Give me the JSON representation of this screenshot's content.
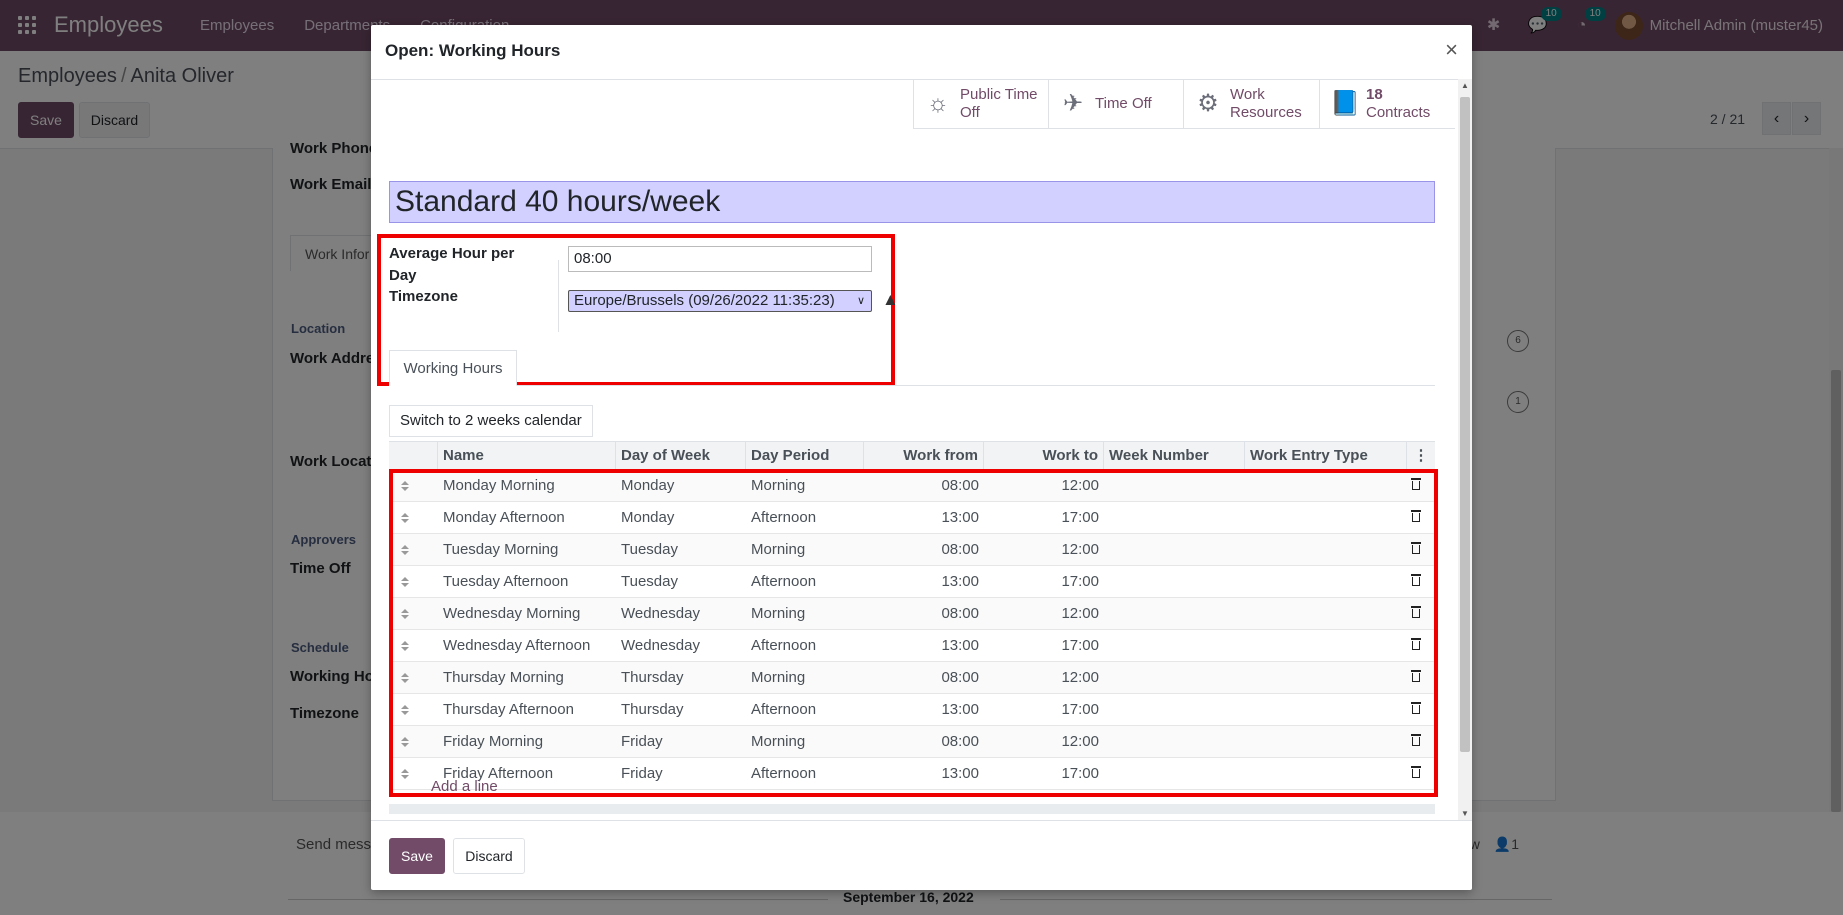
{
  "navbar": {
    "app_name": "Employees",
    "menu": [
      "Employees",
      "Departments",
      "Configuration"
    ],
    "chat_count": "10",
    "activity_count": "10",
    "user": "Mitchell Admin (muster45)"
  },
  "control": {
    "breadcrumb_parent": "Employees",
    "breadcrumb_current": "Anita Oliver",
    "save": "Save",
    "discard": "Discard",
    "pager": "2 / 21"
  },
  "background_form": {
    "work_phone": "Work Phone",
    "work_email": "Work Email",
    "tab_work_info": "Work Infor",
    "section_location": "Location",
    "work_address": "Work Addre",
    "work_location": "Work Locat",
    "section_approvers": "Approvers",
    "time_off": "Time Off",
    "section_schedule": "Schedule",
    "working_hours": "Working Ho",
    "timezone": "Timezone",
    "badge_1": "6",
    "badge_2": "1"
  },
  "chatter": {
    "send_message": "Send messa",
    "follow": "ow",
    "followers": "1",
    "date": "September 16, 2022"
  },
  "modal": {
    "title": "Open: Working Hours",
    "stat_buttons": [
      {
        "icon": "public-holiday-icon",
        "label": "Public Time Off",
        "line1": "Public Time",
        "line2": "Off"
      },
      {
        "icon": "plane-icon",
        "label": "Time Off"
      },
      {
        "icon": "gears-icon",
        "label": "Work Resources",
        "line1": "Work",
        "line2": "Resources"
      },
      {
        "icon": "book-icon",
        "count": "18",
        "label": "Contracts"
      }
    ],
    "name": "Standard 40 hours/week",
    "avg_hour_label_1": "Average Hour per",
    "avg_hour_label_2": "Day",
    "avg_hour_value": "08:00",
    "timezone_label": "Timezone",
    "timezone_value": "Europe/Brussels (09/26/2022 11:35:23)",
    "tab": "Working Hours",
    "switch_button": "Switch to 2 weeks calendar",
    "columns": [
      "Name",
      "Day of Week",
      "Day Period",
      "Work from",
      "Work to",
      "Week Number",
      "Work Entry Type"
    ],
    "rows": [
      {
        "name": "Monday Morning",
        "day": "Monday",
        "period": "Morning",
        "from": "08:00",
        "to": "12:00"
      },
      {
        "name": "Monday Afternoon",
        "day": "Monday",
        "period": "Afternoon",
        "from": "13:00",
        "to": "17:00"
      },
      {
        "name": "Tuesday Morning",
        "day": "Tuesday",
        "period": "Morning",
        "from": "08:00",
        "to": "12:00"
      },
      {
        "name": "Tuesday Afternoon",
        "day": "Tuesday",
        "period": "Afternoon",
        "from": "13:00",
        "to": "17:00"
      },
      {
        "name": "Wednesday Morning",
        "day": "Wednesday",
        "period": "Morning",
        "from": "08:00",
        "to": "12:00"
      },
      {
        "name": "Wednesday Afternoon",
        "day": "Wednesday",
        "period": "Afternoon",
        "from": "13:00",
        "to": "17:00"
      },
      {
        "name": "Thursday Morning",
        "day": "Thursday",
        "period": "Morning",
        "from": "08:00",
        "to": "12:00"
      },
      {
        "name": "Thursday Afternoon",
        "day": "Thursday",
        "period": "Afternoon",
        "from": "13:00",
        "to": "17:00"
      },
      {
        "name": "Friday Morning",
        "day": "Friday",
        "period": "Morning",
        "from": "08:00",
        "to": "12:00"
      },
      {
        "name": "Friday Afternoon",
        "day": "Friday",
        "period": "Afternoon",
        "from": "13:00",
        "to": "17:00"
      }
    ],
    "add_line": "Add a line",
    "save": "Save",
    "discard": "Discard"
  },
  "colors": {
    "brand": "#714B67",
    "highlight": "#e00000",
    "badge": "#017e84"
  }
}
